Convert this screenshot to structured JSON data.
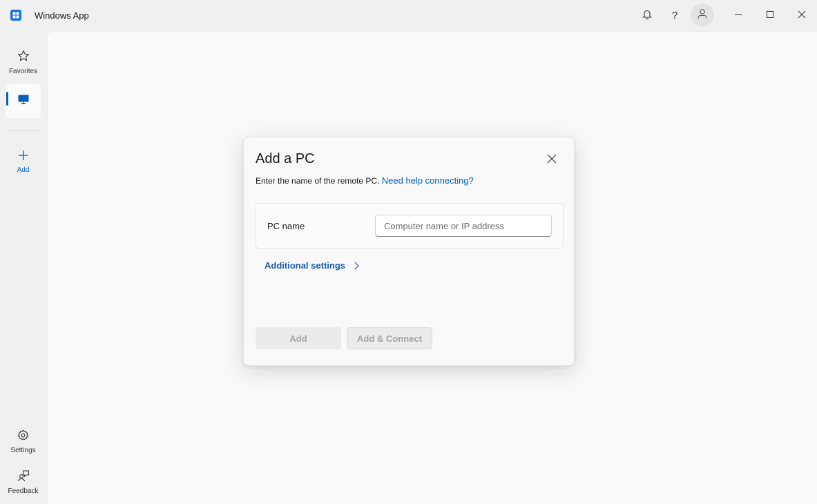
{
  "window": {
    "title": "Windows App",
    "help_glyph": "?"
  },
  "sidebar": {
    "items": [
      {
        "label": "Favorites",
        "icon": "star-icon"
      },
      {
        "label": "",
        "icon": "monitor-icon",
        "selected": true
      },
      {
        "label": "Add",
        "icon": "plus-icon"
      }
    ],
    "bottom_items": [
      {
        "label": "Settings",
        "icon": "gear-icon"
      },
      {
        "label": "Feedback",
        "icon": "feedback-icon"
      }
    ]
  },
  "dialog": {
    "title": "Add a PC",
    "subtitle": "Enter the name of the remote PC.",
    "help_link": "Need help connecting?",
    "field_label": "PC name",
    "field_value": "",
    "field_placeholder": "Computer name or IP address",
    "additional_settings": "Additional settings",
    "add_button": "Add",
    "add_connect_button": "Add & Connect"
  },
  "colors": {
    "accent": "#005fb8",
    "link": "#005fb8",
    "disabled_text": "#a3a3a3"
  }
}
